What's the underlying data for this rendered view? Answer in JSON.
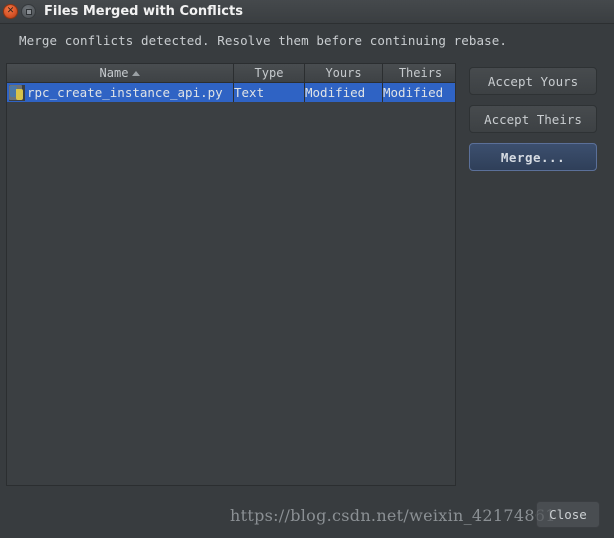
{
  "window": {
    "title": "Files Merged with Conflicts",
    "close_icon": "close-icon",
    "maximize_icon": "maximize-icon"
  },
  "message": "Merge conflicts detected. Resolve them before continuing rebase.",
  "table": {
    "columns": [
      {
        "label": "Name",
        "sorted": "ascending",
        "sort_icon": "sort-ascending-icon"
      },
      {
        "label": "Type"
      },
      {
        "label": "Yours"
      },
      {
        "label": "Theirs"
      }
    ],
    "rows": [
      {
        "icon": "python-file-icon",
        "name": "rpc_create_instance_api.py",
        "type": "Text",
        "yours": "Modified",
        "theirs": "Modified",
        "selected": true
      }
    ]
  },
  "actions": {
    "accept_yours": "Accept Yours",
    "accept_theirs": "Accept Theirs",
    "merge": "Merge...",
    "close": "Close"
  },
  "watermark": "https://blog.csdn.net/weixin_42174861",
  "colors": {
    "selection": "#2f63c4",
    "dialog_bg": "#383c3f",
    "titlebar_bg": "#3f4346",
    "default_button_border": "#5b7099",
    "close_button_orange": "#d9562a"
  }
}
